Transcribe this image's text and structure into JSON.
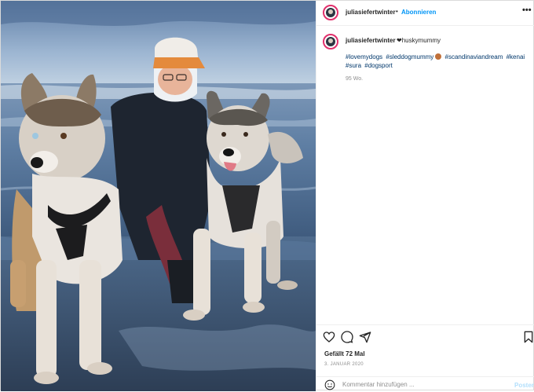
{
  "header": {
    "username": "juliasiefertwinter",
    "separator": "•",
    "follow_label": "Abonnieren",
    "more_icon": "more-dots-icon",
    "more_label": "•••"
  },
  "caption": {
    "username": "juliasiefertwinter",
    "heart": "❤",
    "text": "huskymummy",
    "hashtags": [
      "#lovemydogs",
      "#sleddogmummy",
      "#scandinaviandream",
      "#kenai",
      "#sura",
      "#dogsport"
    ],
    "age": "95 Wo."
  },
  "actions": {
    "icons": [
      "heart-icon",
      "comment-icon",
      "share-icon",
      "bookmark-icon"
    ],
    "likes": "Gefällt 72 Mal",
    "date": "3. JANUAR 2020"
  },
  "comment": {
    "emoji_icon": "emoji-icon",
    "placeholder": "Kommentar hinzufügen ...",
    "post_label": "Posten"
  },
  "colors": {
    "accent": "#0095f6",
    "story_ring": "#e1306c",
    "hashtag": "#00376b",
    "muted": "#8e8e8e"
  }
}
